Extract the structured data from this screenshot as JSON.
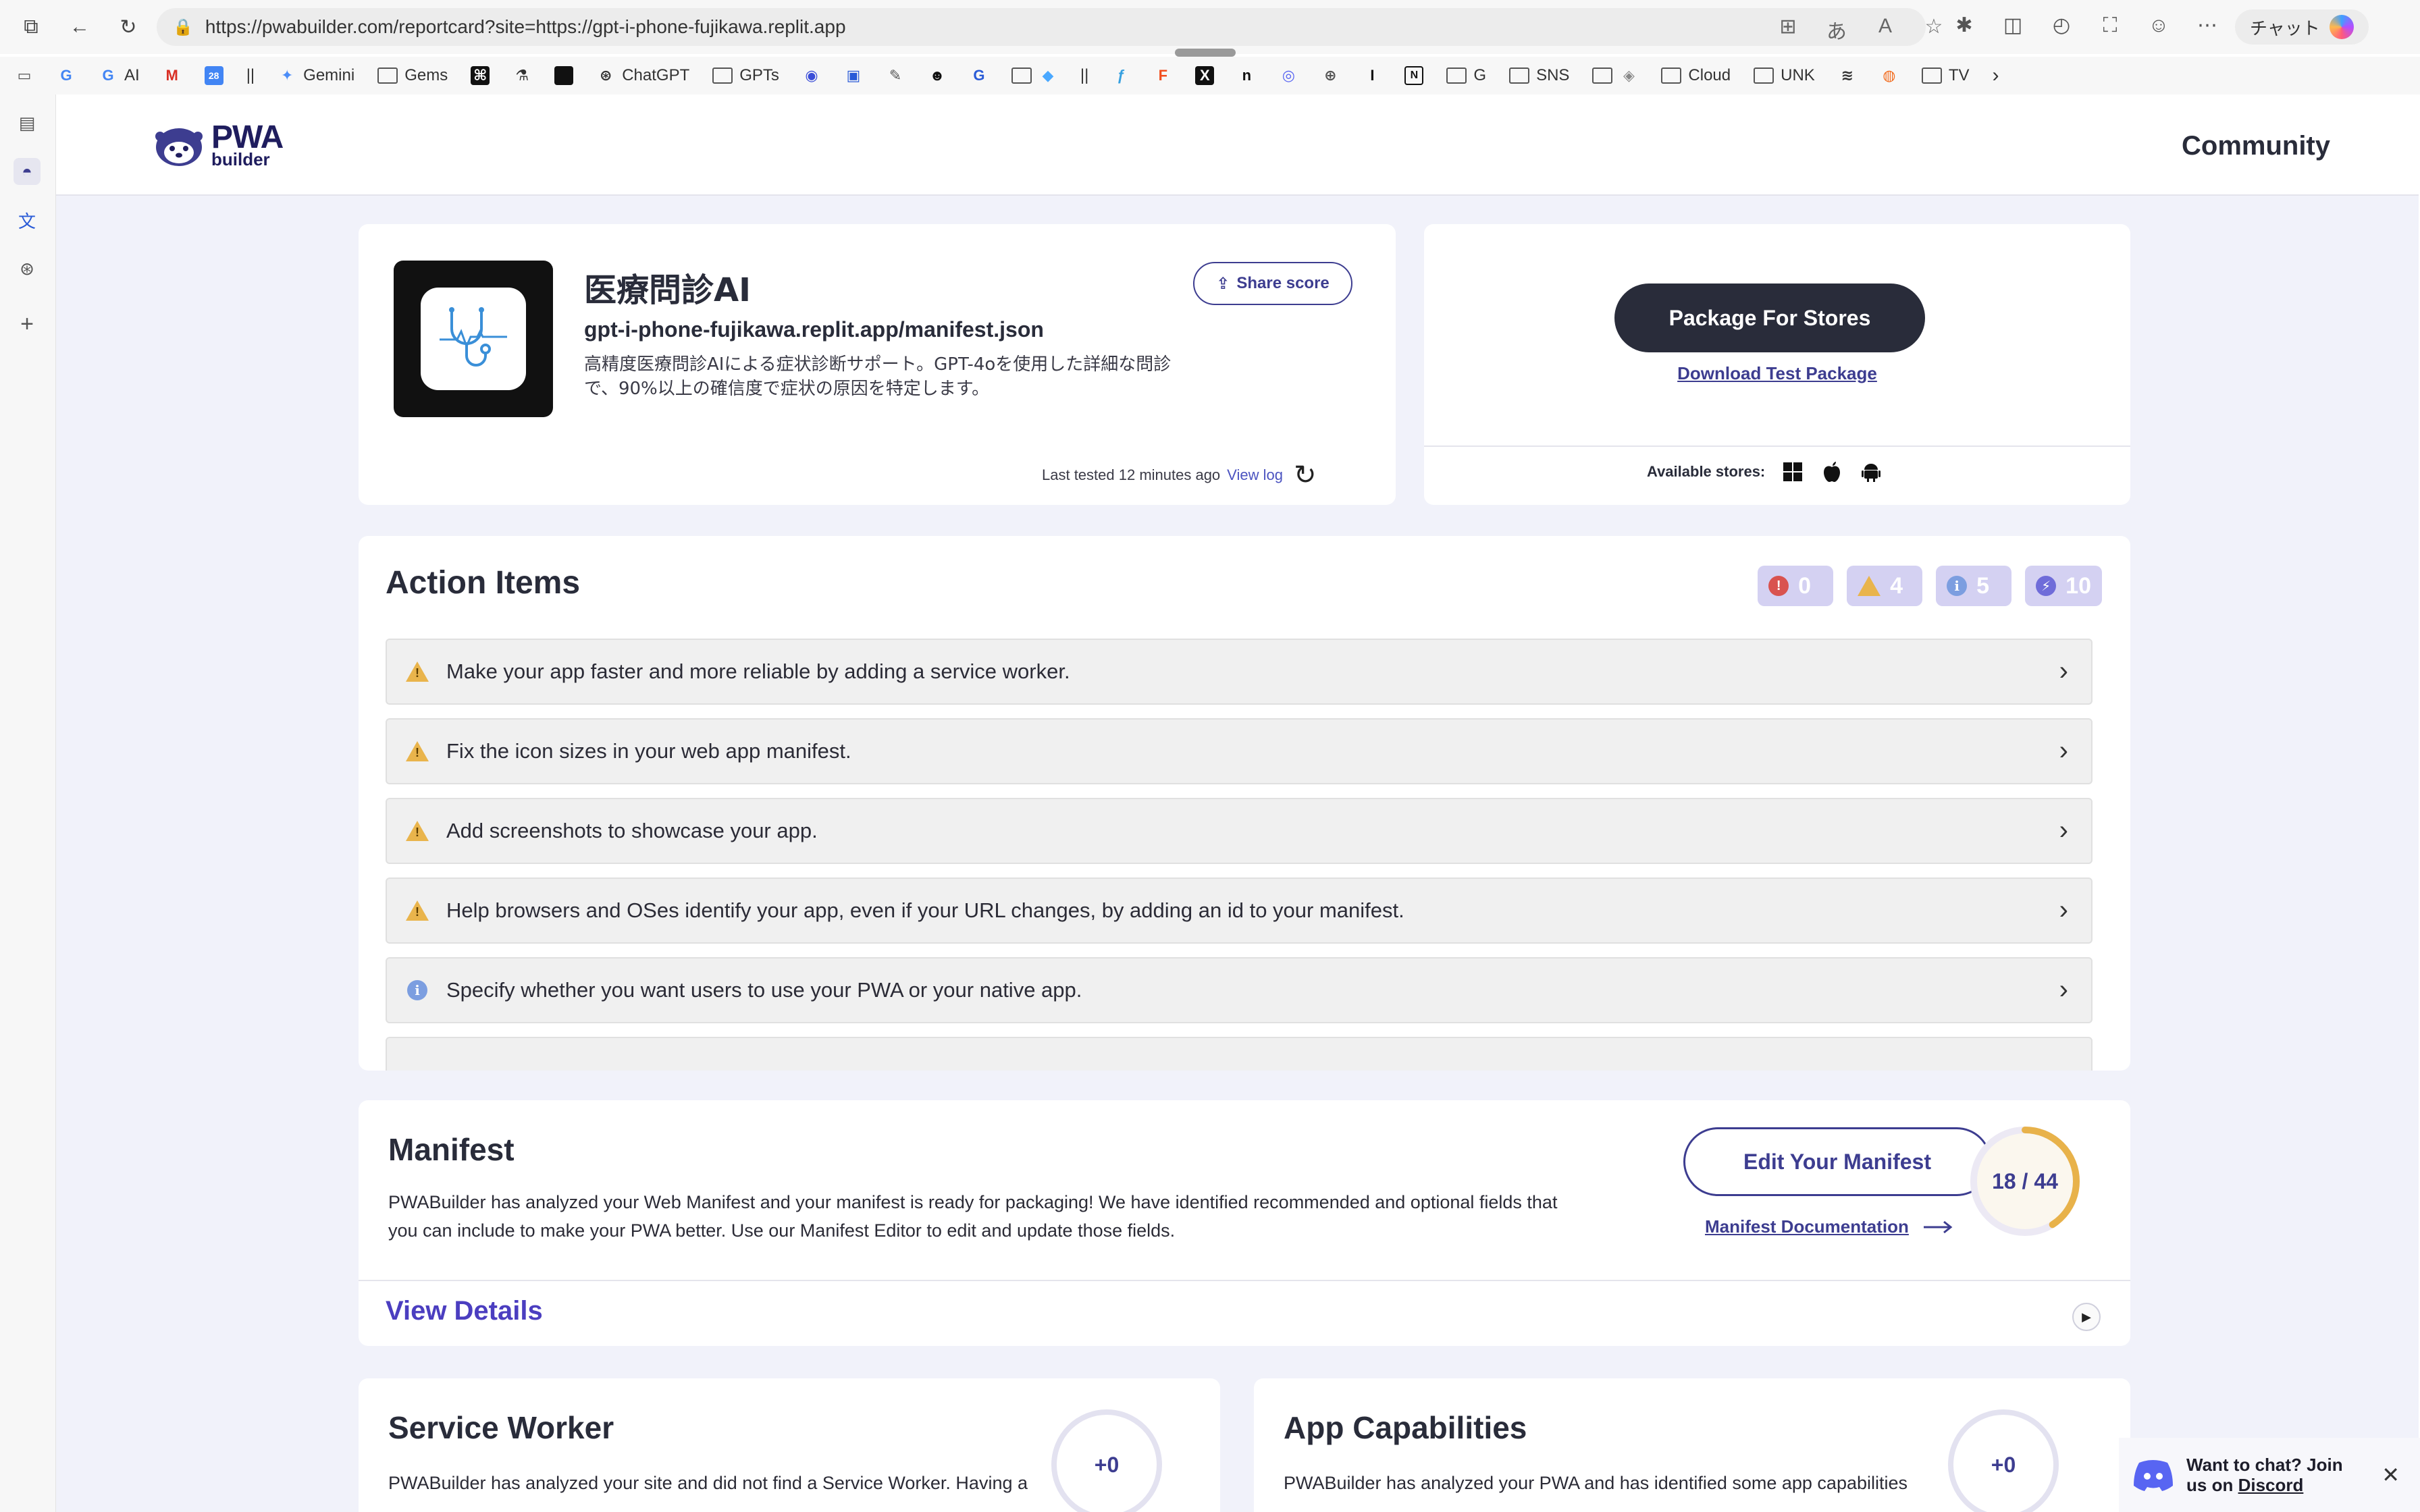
{
  "browser": {
    "url": "https://pwabuilder.com/reportcard?site=https://gpt-i-phone-fujikawa.replit.app",
    "chat_label": "チャット",
    "bookmarks": [
      {
        "label": "",
        "icon": "google-icon"
      },
      {
        "label": "AI",
        "icon": "google-icon"
      },
      {
        "label": "",
        "icon": "gmail-icon"
      },
      {
        "label": "",
        "icon": "calendar-icon"
      },
      {
        "label": "||",
        "icon": ""
      },
      {
        "label": "Gemini",
        "icon": "gemini-icon"
      },
      {
        "label": "Gems",
        "icon": "folder-icon"
      },
      {
        "label": "ChatGPT",
        "icon": "openai-icon"
      },
      {
        "label": "GPTs",
        "icon": "folder-icon"
      },
      {
        "label": "G",
        "icon": "folder-icon"
      },
      {
        "label": "SNS",
        "icon": "folder-icon"
      },
      {
        "label": "Cloud",
        "icon": "folder-icon"
      },
      {
        "label": "UNK",
        "icon": "folder-icon"
      },
      {
        "label": "TV",
        "icon": "folder-icon"
      }
    ]
  },
  "header": {
    "logo_top": "PWA",
    "logo_bottom": "builder",
    "community": "Community"
  },
  "app": {
    "name": "医療問診AI",
    "manifest_url": "gpt-i-phone-fujikawa.replit.app/manifest.json",
    "description": "高精度医療問診AIによる症状診断サポート。GPT-4oを使用した詳細な問診で、90%以上の確信度で症状の原因を特定します。",
    "share_label": "Share score",
    "last_tested": "Last tested 12 minutes ago",
    "view_log": "View log"
  },
  "package": {
    "button": "Package For Stores",
    "download_test": "Download Test Package",
    "stores_label": "Available stores:",
    "stores": [
      "windows-icon",
      "apple-icon",
      "android-icon"
    ]
  },
  "action_items": {
    "title": "Action Items",
    "counts": {
      "errors": "0",
      "warnings": "4",
      "info": "5",
      "enhancements": "10"
    },
    "colors": {
      "error": "#d9534f",
      "warning": "#e9b44c",
      "info": "#7c9ee0",
      "enhancement": "#6f6cd9"
    },
    "items": [
      {
        "type": "warning",
        "text": "Make your app faster and more reliable by adding a service worker."
      },
      {
        "type": "warning",
        "text": "Fix the icon sizes in your web app manifest."
      },
      {
        "type": "warning",
        "text": "Add screenshots to showcase your app."
      },
      {
        "type": "warning",
        "text": "Help browsers and OSes identify your app, even if your URL changes, by adding an id to your manifest."
      },
      {
        "type": "info",
        "text": "Specify whether you want users to use your PWA or your native app."
      }
    ]
  },
  "manifest": {
    "title": "Manifest",
    "text": "PWABuilder has analyzed your Web Manifest and your manifest is ready for packaging! We have identified recommended and optional fields that you can include to make your PWA better. Use our Manifest Editor to edit and update those fields.",
    "edit_button": "Edit Your Manifest",
    "doc_link": "Manifest Documentation",
    "score_label": "18 / 44",
    "score_fraction": 0.41,
    "view_details": "View Details"
  },
  "service_worker": {
    "title": "Service Worker",
    "text": "PWABuilder has analyzed your site and did not find a Service Worker. Having a",
    "score": "+0"
  },
  "app_capabilities": {
    "title": "App Capabilities",
    "text": "PWABuilder has analyzed your PWA and has identified some app capabilities",
    "score": "+0"
  },
  "discord": {
    "line1": "Want to chat? Join",
    "line2_prefix": "us on ",
    "link": "Discord"
  },
  "colors": {
    "brand_dark": "#292c3a",
    "brand_purple": "#3d3d90",
    "page_bg": "#f1f2fa",
    "score_ring": "#e8b24a"
  }
}
